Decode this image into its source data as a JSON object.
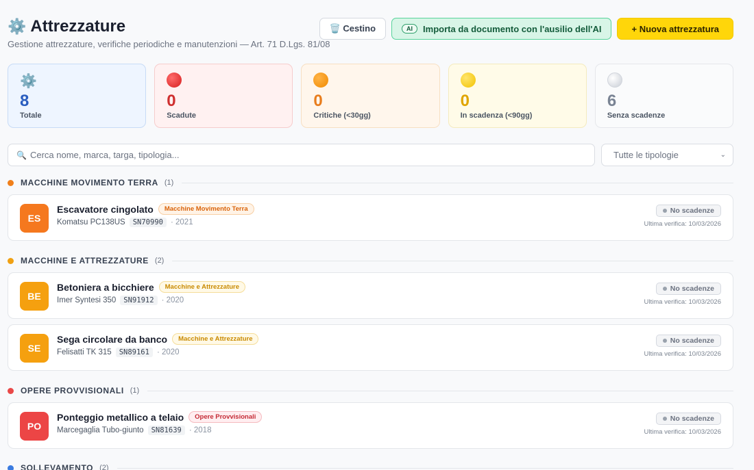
{
  "header": {
    "icon": "gear-icon",
    "title": "Attrezzature",
    "subtitle": "Gestione attrezzature, verifiche periodiche e manutenzioni — Art. 71 D.Lgs. 81/08",
    "trash_label": "🗑️ Cestino",
    "ai_chip": "AI",
    "ai_label": "Importa da documento con l'ausilio dell'AI",
    "new_label": "+ Nuova attrezzatura"
  },
  "stats": [
    {
      "icon": "gear-icon",
      "value": "8",
      "label": "Totale"
    },
    {
      "icon": "red-circle-icon",
      "value": "0",
      "label": "Scadute"
    },
    {
      "icon": "orange-circle-icon",
      "value": "0",
      "label": "Critiche (<30gg)"
    },
    {
      "icon": "yellow-circle-icon",
      "value": "0",
      "label": "In scadenza (<90gg)"
    },
    {
      "icon": "white-circle-icon",
      "value": "6",
      "label": "Senza scadenze"
    }
  ],
  "search": {
    "placeholder": "Cerca nome, marca, targa, tipologia..."
  },
  "filter": {
    "selected": "Tutte le tipologie"
  },
  "groups": [
    {
      "name": "MACCHINE MOVIMENTO TERRA",
      "count": "(1)",
      "color": "#f07f1a",
      "items": [
        {
          "initials": "ES",
          "color": "#f5781e",
          "name": "Escavatore cingolato",
          "tag": "Macchine Movimento Terra",
          "model": "Komatsu PC138US",
          "sn": "SN70990",
          "year": "· 2021",
          "status": "No scadenze",
          "last": "Ultima verifica: 10/03/2026"
        }
      ]
    },
    {
      "name": "MACCHINE E ATTREZZATURE",
      "count": "(2)",
      "color": "#f0a012",
      "items": [
        {
          "initials": "BE",
          "color": "#f5a00f",
          "name": "Betoniera a bicchiere",
          "tag": "Macchine e Attrezzature",
          "model": "Imer Syntesi 350",
          "sn": "SN91912",
          "year": "· 2020",
          "status": "No scadenze",
          "last": "Ultima verifica: 10/03/2026"
        },
        {
          "initials": "SE",
          "color": "#f5a00f",
          "name": "Sega circolare da banco",
          "tag": "Macchine e Attrezzature",
          "model": "Felisatti TK 315",
          "sn": "SN89161",
          "year": "· 2020",
          "status": "No scadenze",
          "last": "Ultima verifica: 10/03/2026"
        }
      ]
    },
    {
      "name": "OPERE PROVVISIONALI",
      "count": "(1)",
      "color": "#e94848",
      "items": [
        {
          "initials": "PO",
          "color": "#ec4545",
          "name": "Ponteggio metallico a telaio",
          "tag": "Opere Provvisionali",
          "model": "Marcegaglia Tubo-giunto",
          "sn": "SN81639",
          "year": "· 2018",
          "status": "No scadenze",
          "last": "Ultima verifica: 10/03/2026"
        }
      ]
    },
    {
      "name": "SOLLEVAMENTO",
      "count": "(2)",
      "color": "#3a7be0",
      "items": []
    }
  ]
}
